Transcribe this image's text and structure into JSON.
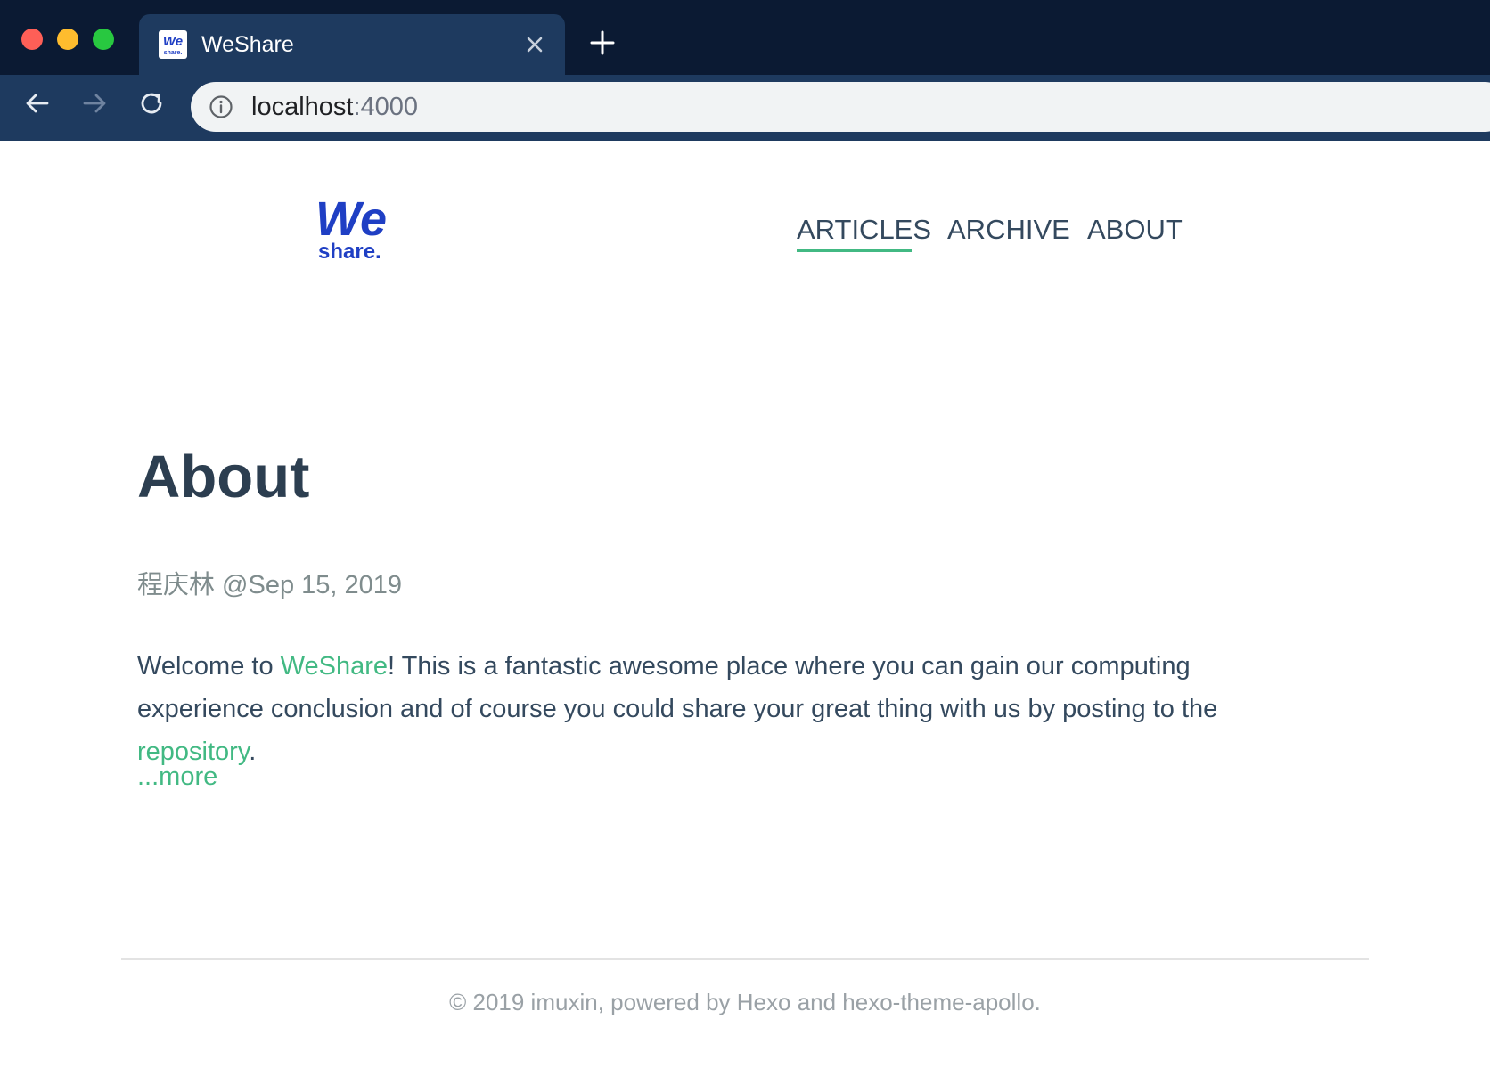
{
  "browser": {
    "tab": {
      "title": "WeShare",
      "favicon": "weshare-favicon-icon"
    },
    "address_bar": {
      "host": "localhost",
      "port": ":4000"
    },
    "icons": {
      "back": "arrow-left-icon",
      "forward": "arrow-right-icon",
      "reload": "reload-icon",
      "info": "info-icon",
      "close_tab": "close-icon",
      "new_tab": "plus-icon"
    }
  },
  "site": {
    "logo": {
      "top": "We",
      "bottom": "share."
    },
    "nav": [
      {
        "label": "ARTICLES",
        "active": true
      },
      {
        "label": "ARCHIVE",
        "active": false
      },
      {
        "label": "ABOUT",
        "active": false
      }
    ]
  },
  "post": {
    "title": "About",
    "meta": "程庆林 @Sep 15, 2019",
    "body": {
      "before_link": "Welcome to ",
      "link_weshare": "WeShare",
      "middle": "! This is a fantastic awesome place where you can gain our computing experience conclusion and of course you could share your great thing with us by posting to the ",
      "link_repository": "repository",
      "after_link": "."
    },
    "more": "...more"
  },
  "footer": {
    "text": "© 2019 imuxin, powered by Hexo and hexo-theme-apollo."
  },
  "colors": {
    "accent": "#42b983",
    "text": "#34495e",
    "title": "#2c3e50",
    "brand_logo": "#1f3fc4",
    "chrome_dark": "#0b1a33",
    "chrome_tab": "#1e3a5f"
  }
}
